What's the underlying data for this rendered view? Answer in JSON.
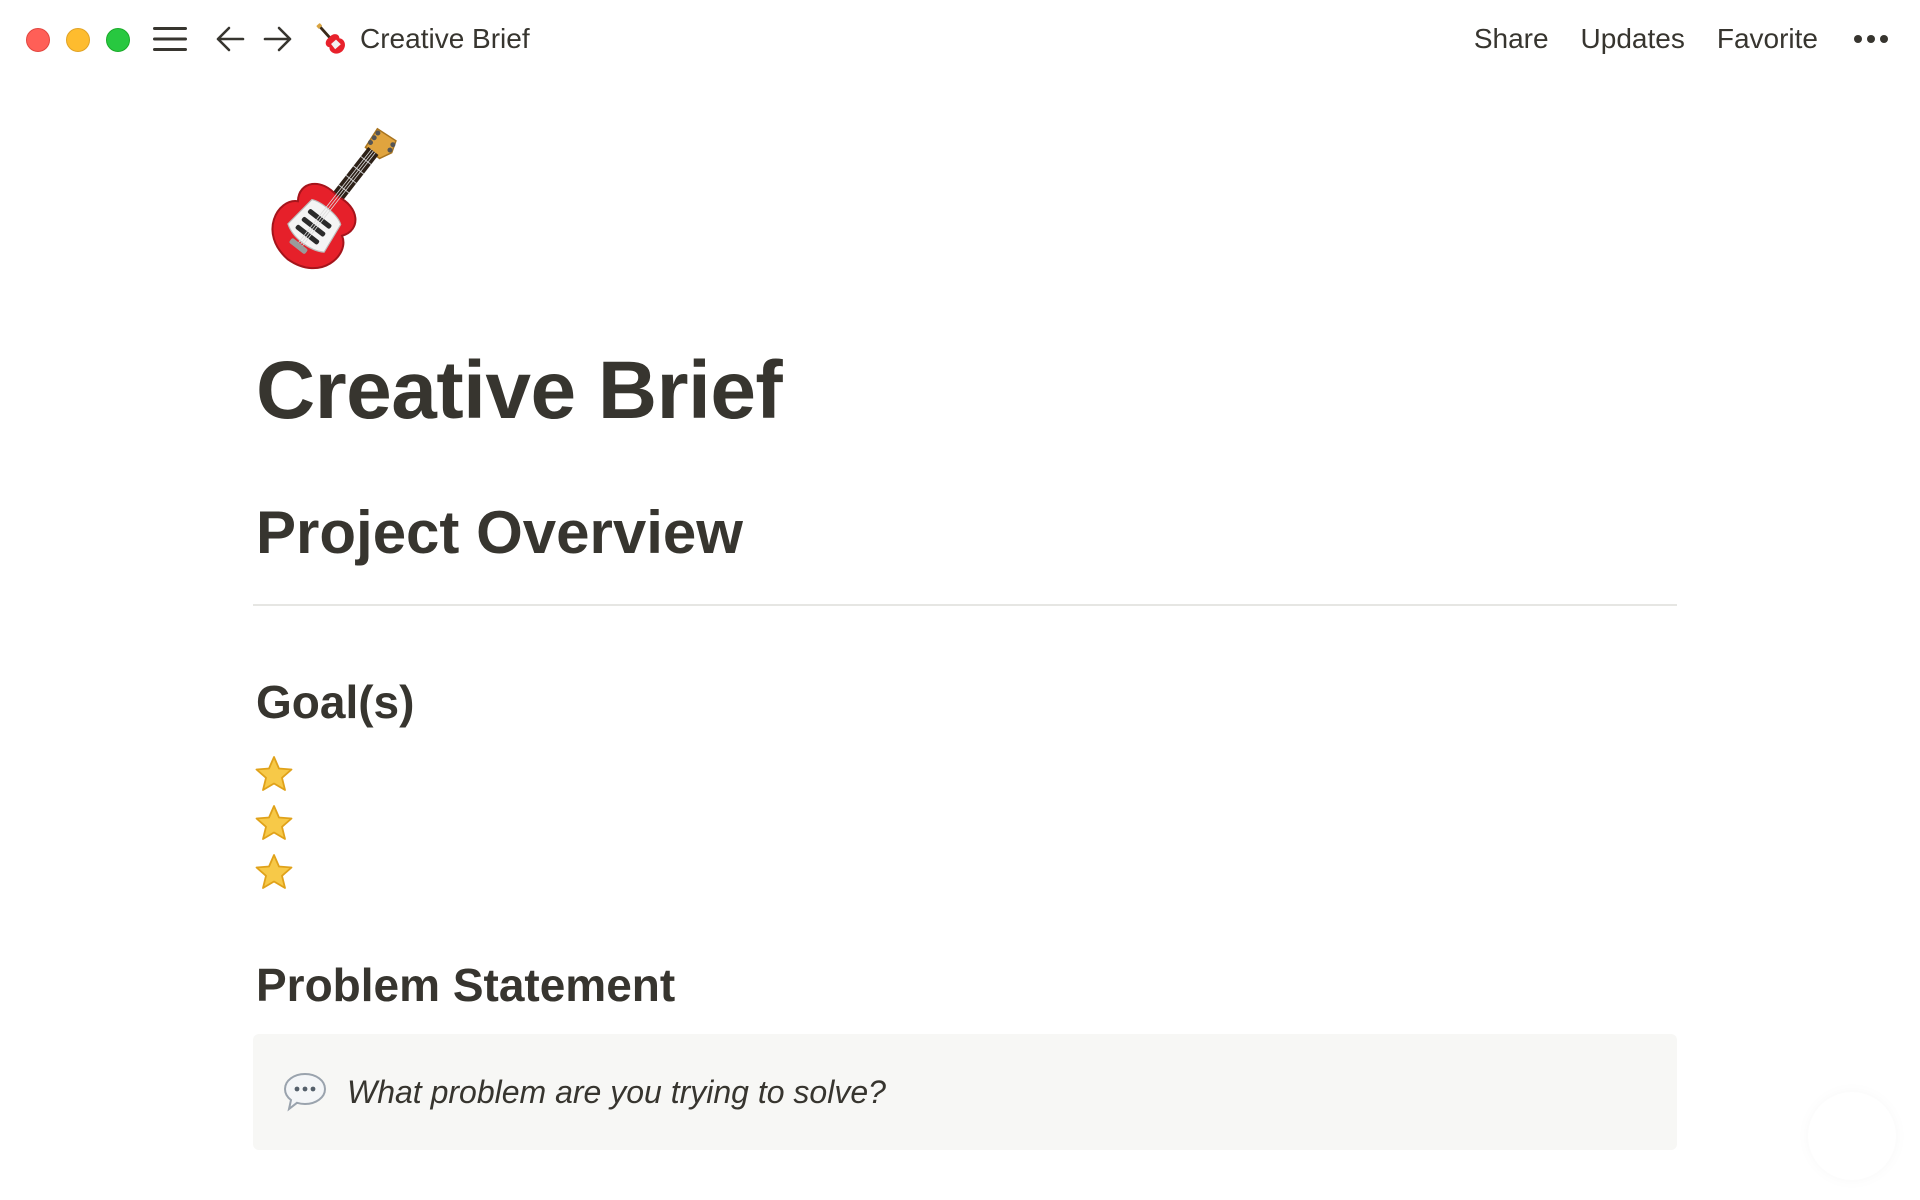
{
  "window": {
    "buttons": [
      "close",
      "minimize",
      "zoom"
    ]
  },
  "topbar": {
    "breadcrumb": {
      "icon": "guitar-emoji",
      "title": "Creative Brief"
    },
    "actions": {
      "share": "Share",
      "updates": "Updates",
      "favorite": "Favorite",
      "more": "more-icon"
    }
  },
  "page": {
    "icon": "guitar-emoji",
    "title": "Creative Brief",
    "sections": {
      "overview": "Project Overview",
      "goals": {
        "heading": "Goal(s)",
        "items": [
          "star-emoji",
          "star-emoji",
          "star-emoji"
        ]
      },
      "problem": {
        "heading": "Problem Statement",
        "callout_icon": "speech-bubble-emoji",
        "callout_text": "What problem are you trying to solve?"
      }
    }
  },
  "colors": {
    "text": "#37352f",
    "divider": "#e6e6e3",
    "callout_bg": "#f7f7f5",
    "close": "#ff5f57",
    "minimize": "#febc2e",
    "zoom": "#28c840"
  }
}
